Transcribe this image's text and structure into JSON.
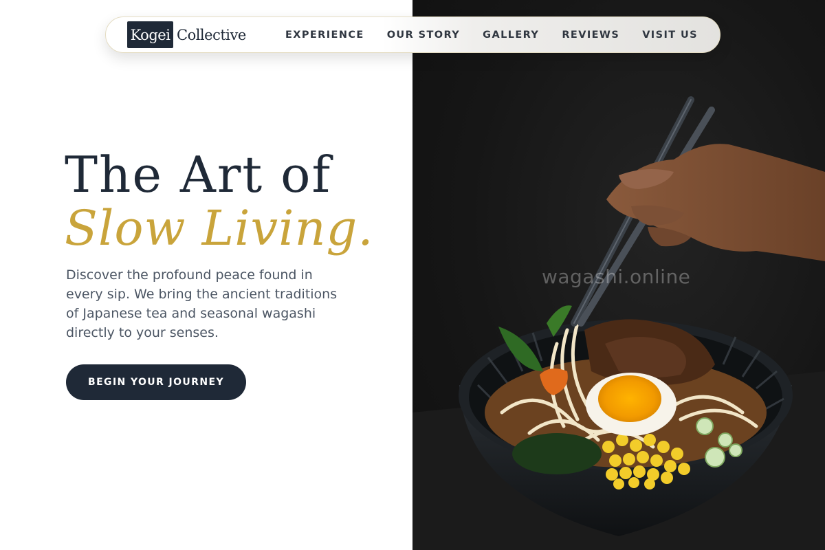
{
  "brand": {
    "mark": "Kogei",
    "name": "Collective"
  },
  "nav": {
    "items": [
      {
        "label": "EXPERIENCE"
      },
      {
        "label": "OUR STORY"
      },
      {
        "label": "GALLERY"
      },
      {
        "label": "REVIEWS"
      },
      {
        "label": "VISIT US"
      }
    ]
  },
  "hero": {
    "headline_line1": "The Art of",
    "headline_line2": "Slow Living.",
    "subtitle": "Discover the profound peace found in every sip. We bring the ancient traditions of Japanese tea and seasonal wagashi directly to your senses.",
    "cta_label": "BEGIN YOUR JOURNEY",
    "image_watermark": "wagashi.online"
  },
  "colors": {
    "primary": "#1f2937",
    "accent_gold": "#c9a43b",
    "body_text": "#4b5563",
    "image_bg": "#161616"
  }
}
